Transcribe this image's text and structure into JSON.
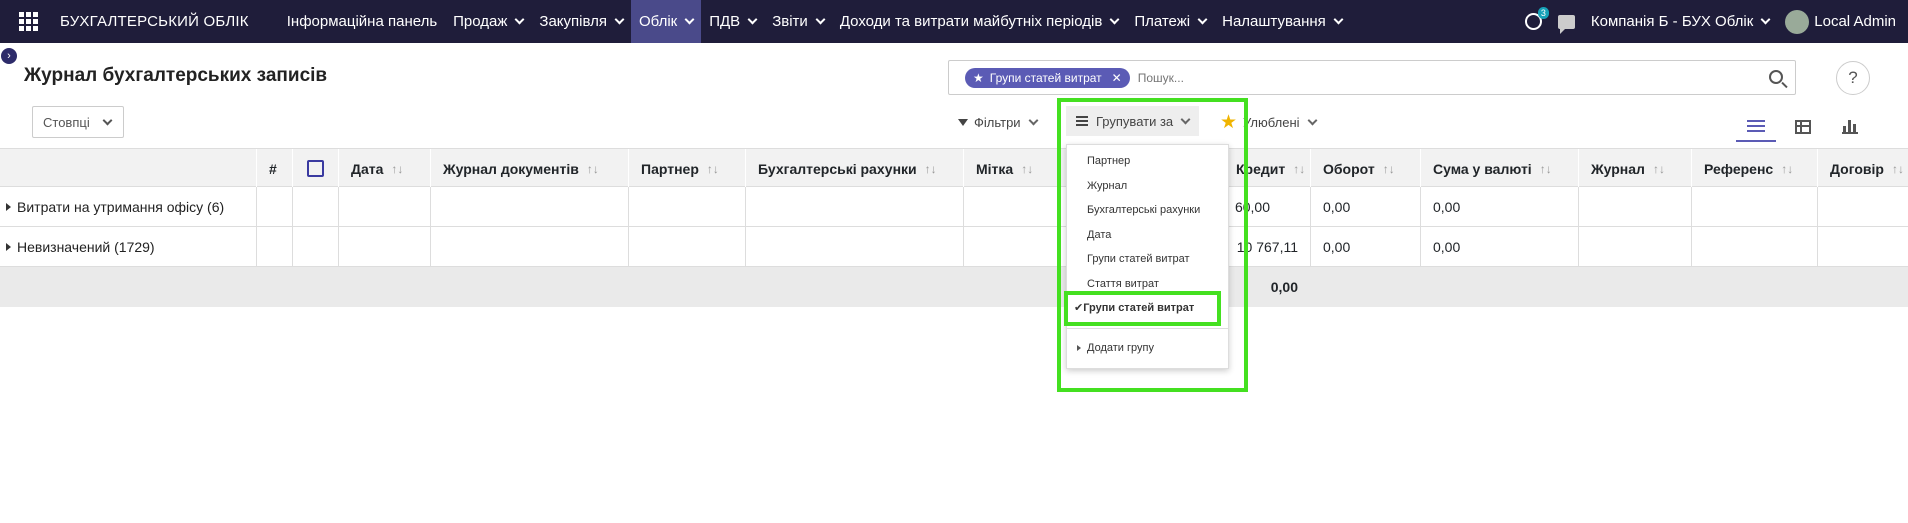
{
  "topbar": {
    "brand": "БУХГАЛТЕРСЬКИЙ ОБЛІК",
    "menu": [
      {
        "label": "Інформаційна панель",
        "dropdown": false
      },
      {
        "label": "Продаж",
        "dropdown": true
      },
      {
        "label": "Закупівля",
        "dropdown": true
      },
      {
        "label": "Облік",
        "dropdown": true,
        "active": true
      },
      {
        "label": "ПДВ",
        "dropdown": true
      },
      {
        "label": "Звіти",
        "dropdown": true
      },
      {
        "label": "Доходи та витрати майбутніх періодів",
        "dropdown": true
      },
      {
        "label": "Платежі",
        "dropdown": true
      },
      {
        "label": "Налаштування",
        "dropdown": true
      }
    ],
    "activity_badge": "3",
    "company": "Компанія Б - БУХ Облік",
    "user": "Local Admin"
  },
  "page": {
    "title": "Журнал бухгалтерських записів",
    "columns_button": "Стовпці"
  },
  "search": {
    "facet": "Групи статей витрат",
    "placeholder": "Пошук..."
  },
  "controls": {
    "filters": "Фільтри",
    "group_by": "Групувати за",
    "favorites": "Улюблені"
  },
  "table": {
    "headers": [
      "#",
      "Дата",
      "Журнал документів",
      "Партнер",
      "Бухгалтерські рахунки",
      "Мітка",
      "Кредит",
      "Оборот",
      "Сума у валюті",
      "Журнал",
      "Референс",
      "Договір"
    ],
    "groups": [
      {
        "label": "Витрати на утримання офісу (6)",
        "credit": "60,00",
        "turnover": "0,00",
        "currency_amount": "0,00"
      },
      {
        "label": "Невизначений (1729)",
        "credit": "10 767,11",
        "turnover": "0,00",
        "currency_amount": "0,00"
      }
    ],
    "footer_turnover": "0,00"
  },
  "groupby_menu": {
    "options": [
      "Партнер",
      "Журнал",
      "Бухгалтерські рахунки",
      "Дата",
      "Групи статей витрат",
      "Стаття витрат"
    ],
    "selected": "Групи статей витрат",
    "add_group": "Додати групу"
  },
  "colors": {
    "topbar": "#1f1d3a",
    "accent": "#5b5bb5",
    "highlight": "#44e020"
  }
}
